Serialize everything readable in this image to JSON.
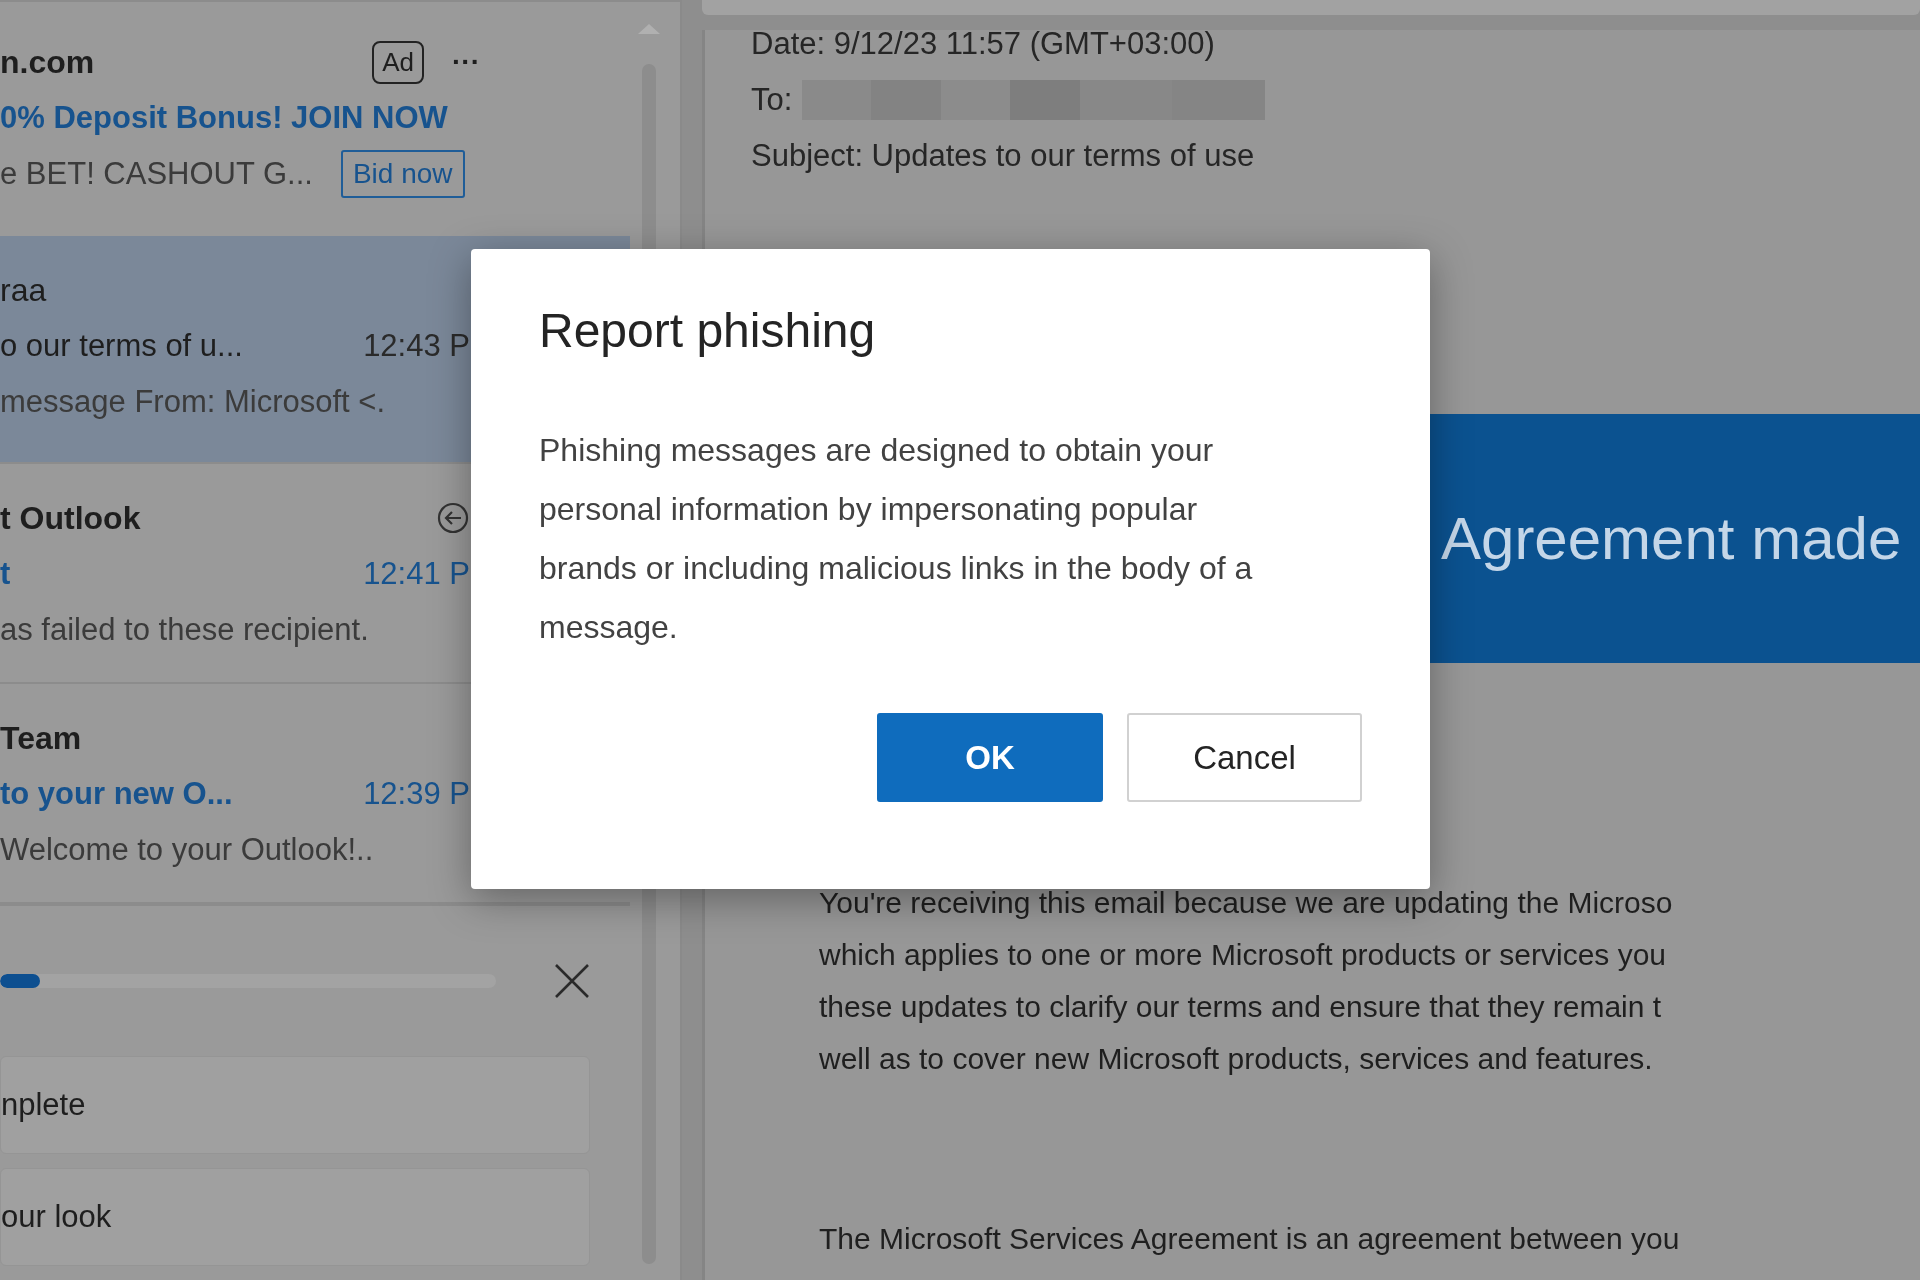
{
  "message_list": {
    "items": [
      {
        "kind": "ad",
        "sender": "n.com",
        "badge": "Ad",
        "more": "···",
        "subject": "0% Deposit Bonus! JOIN NOW",
        "preview": "e BET! CASHOUT G...",
        "action": "Bid now",
        "selected": false
      },
      {
        "kind": "message",
        "sender": "raa",
        "subject": "o our terms of u...",
        "time": "12:43 P",
        "preview": "message From: Microsoft <.",
        "selected": true,
        "unread": false,
        "action_icon": false
      },
      {
        "kind": "message",
        "sender": "t Outlook",
        "subject": "t",
        "time": "12:41 P",
        "preview": "as failed to these recipient.",
        "selected": false,
        "unread": true,
        "action_icon": true
      },
      {
        "kind": "message",
        "sender": "Team",
        "subject": " to your new O...",
        "time": "12:39 P",
        "preview": "Welcome to your Outlook!..",
        "selected": false,
        "unread": true,
        "action_icon": false
      }
    ]
  },
  "setup": {
    "level": 0.08,
    "tasks": [
      {
        "label": "nplete"
      },
      {
        "label": "our look"
      }
    ]
  },
  "reading_pane": {
    "date": "Date: 9/12/23 11:57 (GMT+03:00)",
    "to_label": "To:",
    "subject": "Subject: Updates to our terms of use",
    "banner": "Agreement made",
    "paragraphs": [
      {
        "lines": [
          "You're receiving this email because we are updating the Microso",
          "which applies to one or more Microsoft products or services you",
          "these updates to clarify our terms and ensure that they remain t",
          "well as to cover new Microsoft products, services and features."
        ]
      },
      {
        "lines": [
          "The Microsoft Services Agreement is an agreement between you"
        ]
      }
    ]
  },
  "dialog": {
    "title": "Report phishing",
    "body": "Phishing messages are designed to obtain your personal information by impersonating popular brands or including malicious links in the body of a message.",
    "buttons": [
      {
        "label": "OK",
        "primary": true
      },
      {
        "label": "Cancel",
        "primary": false
      }
    ]
  }
}
